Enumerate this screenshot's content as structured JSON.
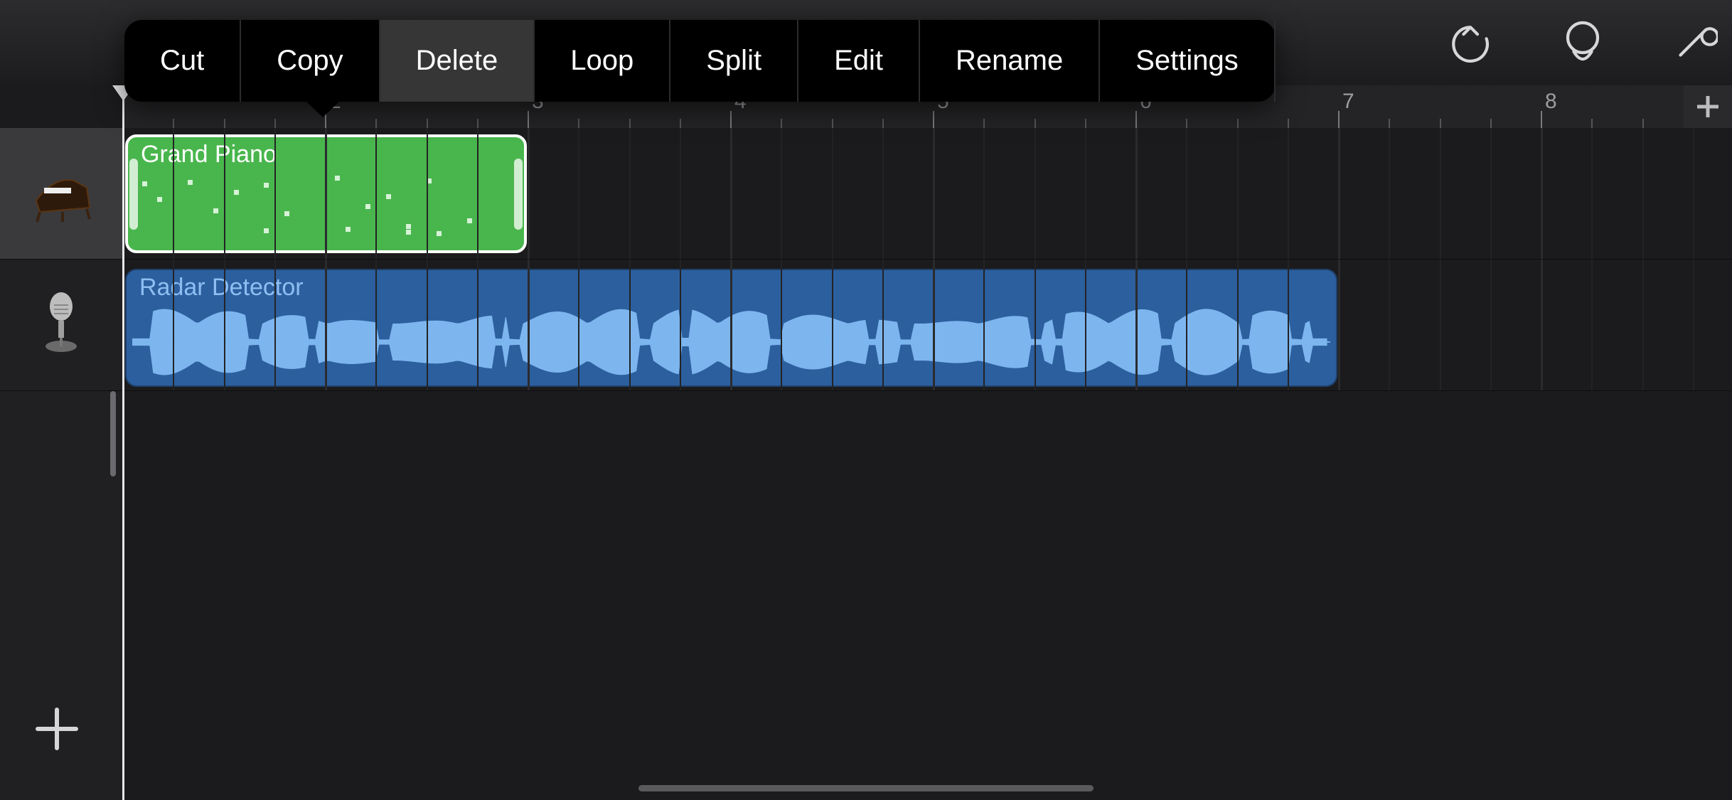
{
  "ruler": {
    "bars": [
      2,
      3,
      4,
      5,
      6,
      7,
      8
    ]
  },
  "context_menu": {
    "items": [
      {
        "id": "cut",
        "label": "Cut"
      },
      {
        "id": "copy",
        "label": "Copy"
      },
      {
        "id": "delete",
        "label": "Delete"
      },
      {
        "id": "loop",
        "label": "Loop"
      },
      {
        "id": "split",
        "label": "Split"
      },
      {
        "id": "edit",
        "label": "Edit"
      },
      {
        "id": "rename",
        "label": "Rename"
      },
      {
        "id": "settings",
        "label": "Settings"
      }
    ]
  },
  "tracks": [
    {
      "instrument_icon": "piano",
      "selected": true,
      "regions": [
        {
          "name": "Grand Piano",
          "type": "midi",
          "selected": true
        }
      ]
    },
    {
      "instrument_icon": "microphone",
      "selected": false,
      "regions": [
        {
          "name": "Radar Detector",
          "type": "audio",
          "selected": false
        }
      ]
    }
  ]
}
